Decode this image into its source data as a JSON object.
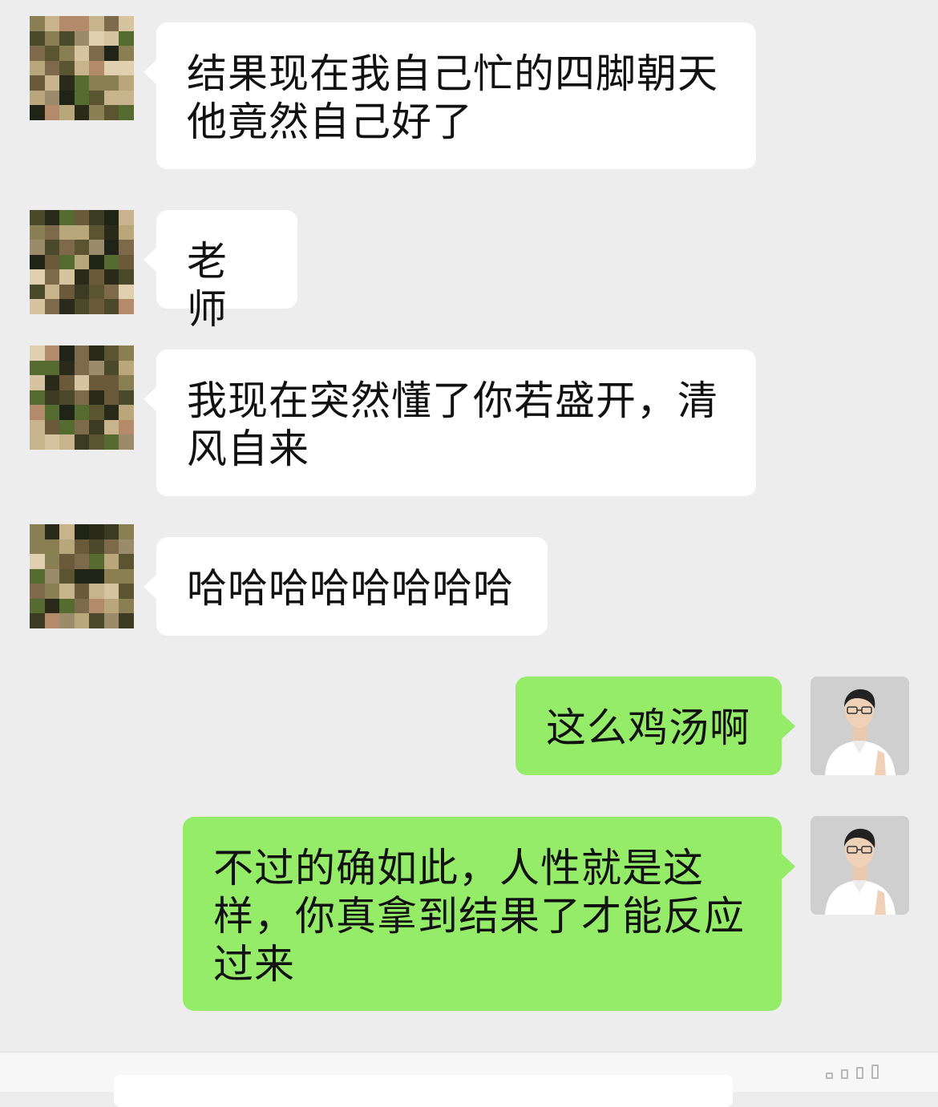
{
  "messages": [
    {
      "side": "left",
      "text": "结果现在我自己忙的四脚朝天\n他竟然自己好了"
    },
    {
      "side": "left",
      "text": "老师"
    },
    {
      "side": "left",
      "text": "我现在突然懂了你若盛开，清\n风自来"
    },
    {
      "side": "left",
      "text": "哈哈哈哈哈哈哈哈"
    },
    {
      "side": "right",
      "text": "这么鸡汤啊"
    },
    {
      "side": "right",
      "text": "不过的确如此，人性就是这\n样，你真拿到结果了才能反应\n过来"
    }
  ],
  "colors": {
    "background": "#ededed",
    "incoming_bubble": "#ffffff",
    "outgoing_bubble": "#95ec69",
    "text": "#111111"
  },
  "icons": {
    "contact_avatar": "pixelated-avatar",
    "user_avatar": "person-photo-avatar"
  }
}
